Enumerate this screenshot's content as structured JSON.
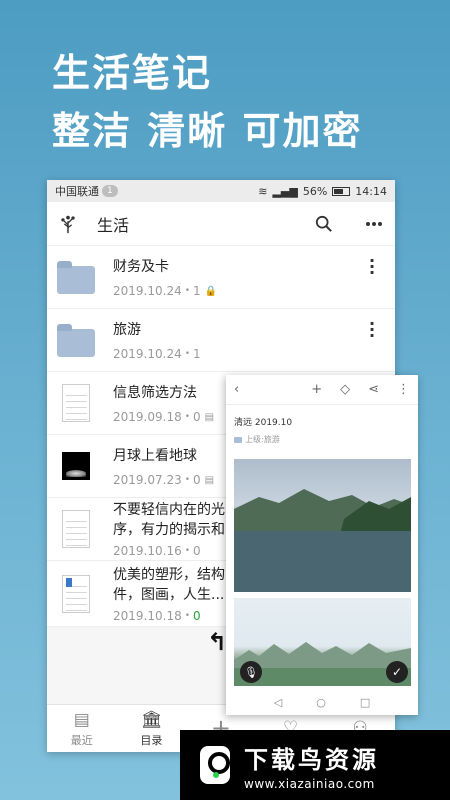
{
  "headline": {
    "line1": "生活笔记",
    "line2": "整洁 清晰 可加密"
  },
  "statusbar": {
    "carrier": "中国联通",
    "badge": "1",
    "battery": "56%",
    "time": "14:14"
  },
  "appbar": {
    "title": "生活"
  },
  "items": [
    {
      "title": "财务及卡",
      "date": "2019.10.24",
      "sep": "•",
      "count": "1",
      "thumb": "folder",
      "locked": true
    },
    {
      "title": "旅游",
      "date": "2019.10.24",
      "sep": "•",
      "count": "1",
      "thumb": "folder"
    },
    {
      "title": "信息筛选方法",
      "date": "2019.09.18",
      "sep": "•",
      "count": "0",
      "thumb": "doc"
    },
    {
      "title": "月球上看地球",
      "date": "2019.07.23",
      "sep": "•",
      "count": "0",
      "thumb": "moon"
    },
    {
      "title": "不要轻信内在的光 序，有力的揭示和",
      "date": "2019.10.16",
      "sep": "•",
      "count": "0",
      "thumb": "doc"
    },
    {
      "title": "优美的塑形，结构 件，图画，人生...",
      "date": "2019.10.18",
      "sep": "•",
      "count": "0",
      "thumb": "doc-mark"
    }
  ],
  "bottomnav": {
    "recent": "最近",
    "catalog": "目录"
  },
  "card": {
    "date": "清远 2019.10",
    "parent": "上级:旅游"
  },
  "watermark": {
    "name": "下载鸟资源",
    "url": "www.xiazainiao.com"
  }
}
